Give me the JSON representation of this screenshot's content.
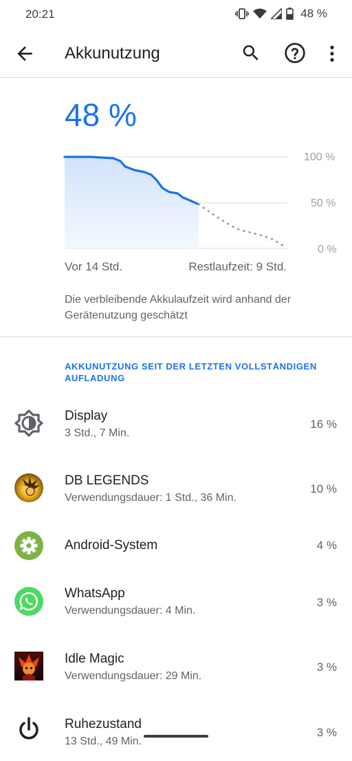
{
  "status_bar": {
    "time": "20:21",
    "battery_percent": "48 %"
  },
  "header": {
    "title": "Akkunutzung"
  },
  "summary": {
    "battery_level": "48 %",
    "chart_labels": {
      "top": "100 %",
      "mid": "50 %",
      "bottom": "0 %"
    },
    "since_label": "Vor 14 Std.",
    "remaining_label": "Restlaufzeit: 9 Std.",
    "estimate_note": "Die verbleibende Akkulaufzeit wird anhand der Gerätenutzung geschätzt"
  },
  "usage": {
    "section_title": "AKKUNUTZUNG SEIT DER LETZTEN VOLLSTÄNDIGEN AUFLADUNG",
    "items": [
      {
        "name": "Display",
        "detail": "3 Std., 7 Min.",
        "percent": "16 %",
        "icon": "display-brightness-icon"
      },
      {
        "name": "DB LEGENDS",
        "detail": "Verwendungsdauer: 1 Std., 36 Min.",
        "percent": "10 %",
        "icon": "db-legends-app-icon"
      },
      {
        "name": "Android-System",
        "detail": "",
        "percent": "4 %",
        "icon": "android-system-gear-icon"
      },
      {
        "name": "WhatsApp",
        "detail": "Verwendungsdauer: 4 Min.",
        "percent": "3 %",
        "icon": "whatsapp-icon"
      },
      {
        "name": "Idle Magic",
        "detail": "Verwendungsdauer: 29 Min.",
        "percent": "3 %",
        "icon": "idle-magic-app-icon"
      },
      {
        "name": "Ruhezustand",
        "detail": "13 Std., 49 Min.",
        "percent": "3 %",
        "icon": "power-icon"
      }
    ]
  },
  "colors": {
    "accent": "#1a73e8",
    "chart_fill": "#e8f0fe",
    "whatsapp": "#4cd964",
    "android_system": "#7cb342"
  }
}
